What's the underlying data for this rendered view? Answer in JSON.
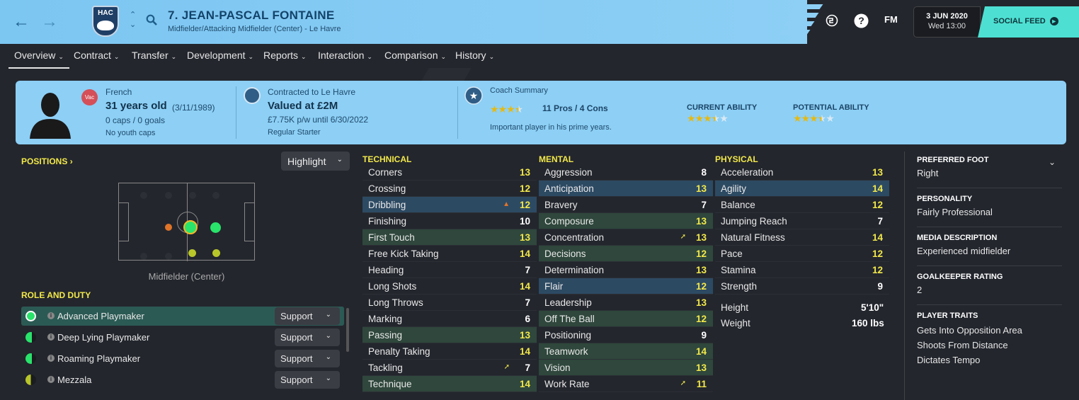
{
  "header": {
    "title": "7. JEAN-PASCAL FONTAINE",
    "subtitle": "Midfielder/Attacking Midfielder (Center) - Le Havre",
    "club_crest": "HAC",
    "fm_label": "FM",
    "date": "3 JUN 2020",
    "time": "Wed 13:00",
    "social_label": "SOCIAL FEED"
  },
  "tabs": [
    "Overview",
    "Contract",
    "Transfer",
    "Development",
    "Reports",
    "Interaction",
    "Comparison",
    "History"
  ],
  "summary": {
    "vacation_badge": "Vac",
    "nationality": "French",
    "age": "31 years old",
    "dob": "(3/11/1989)",
    "caps": "0 caps / 0 goals",
    "youth_caps": "No youth caps",
    "contract": "Contracted to Le Havre",
    "value": "Valued at £2M",
    "wage": "£7.75K p/w until 6/30/2022",
    "squad_status": "Regular Starter",
    "coach_summary_title": "Coach Summary",
    "coach_rating_stars": 3.5,
    "pros_cons": "11 Pros / 4 Cons",
    "coach_note": "Important player in his prime years.",
    "current_ability_label": "CURRENT ABILITY",
    "current_ability_stars": 3.5,
    "potential_ability_label": "POTENTIAL ABILITY",
    "potential_ability_stars": 3.5
  },
  "positions": {
    "title": "POSITIONS",
    "highlight_label": "Highlight",
    "position_name": "Midfielder (Center)"
  },
  "roles": {
    "title": "ROLE AND DUTY",
    "items": [
      {
        "name": "Advanced Playmaker",
        "duty": "Support"
      },
      {
        "name": "Deep Lying Playmaker",
        "duty": "Support"
      },
      {
        "name": "Roaming Playmaker",
        "duty": "Support"
      },
      {
        "name": "Mezzala",
        "duty": "Support"
      }
    ]
  },
  "technical": {
    "title": "TECHNICAL",
    "attrs": [
      {
        "name": "Corners",
        "value": "13"
      },
      {
        "name": "Crossing",
        "value": "12"
      },
      {
        "name": "Dribbling",
        "value": "12"
      },
      {
        "name": "Finishing",
        "value": "10"
      },
      {
        "name": "First Touch",
        "value": "13"
      },
      {
        "name": "Free Kick Taking",
        "value": "14"
      },
      {
        "name": "Heading",
        "value": "7"
      },
      {
        "name": "Long Shots",
        "value": "14"
      },
      {
        "name": "Long Throws",
        "value": "7"
      },
      {
        "name": "Marking",
        "value": "6"
      },
      {
        "name": "Passing",
        "value": "13"
      },
      {
        "name": "Penalty Taking",
        "value": "14"
      },
      {
        "name": "Tackling",
        "value": "7"
      },
      {
        "name": "Technique",
        "value": "14"
      }
    ]
  },
  "mental": {
    "title": "MENTAL",
    "attrs": [
      {
        "name": "Aggression",
        "value": "8"
      },
      {
        "name": "Anticipation",
        "value": "13"
      },
      {
        "name": "Bravery",
        "value": "7"
      },
      {
        "name": "Composure",
        "value": "13"
      },
      {
        "name": "Concentration",
        "value": "13"
      },
      {
        "name": "Decisions",
        "value": "12"
      },
      {
        "name": "Determination",
        "value": "13"
      },
      {
        "name": "Flair",
        "value": "12"
      },
      {
        "name": "Leadership",
        "value": "13"
      },
      {
        "name": "Off The Ball",
        "value": "12"
      },
      {
        "name": "Positioning",
        "value": "9"
      },
      {
        "name": "Teamwork",
        "value": "14"
      },
      {
        "name": "Vision",
        "value": "13"
      },
      {
        "name": "Work Rate",
        "value": "11"
      }
    ]
  },
  "physical": {
    "title": "PHYSICAL",
    "attrs": [
      {
        "name": "Acceleration",
        "value": "13"
      },
      {
        "name": "Agility",
        "value": "14"
      },
      {
        "name": "Balance",
        "value": "12"
      },
      {
        "name": "Jumping Reach",
        "value": "7"
      },
      {
        "name": "Natural Fitness",
        "value": "14"
      },
      {
        "name": "Pace",
        "value": "12"
      },
      {
        "name": "Stamina",
        "value": "12"
      },
      {
        "name": "Strength",
        "value": "9"
      }
    ],
    "height_label": "Height",
    "height": "5'10\"",
    "weight_label": "Weight",
    "weight": "160 lbs"
  },
  "info": {
    "preferred_foot_label": "PREFERRED FOOT",
    "preferred_foot": "Right",
    "personality_label": "PERSONALITY",
    "personality": "Fairly Professional",
    "media_label": "MEDIA DESCRIPTION",
    "media": "Experienced midfielder",
    "gk_label": "GOALKEEPER RATING",
    "gk": "2",
    "traits_label": "PLAYER TRAITS",
    "traits": [
      "Gets Into Opposition Area",
      "Shoots From Distance",
      "Dictates Tempo"
    ]
  },
  "colors": {
    "accent_yellow": "#f2e84a",
    "sky": "#8dcff5",
    "teal": "#4de0d2",
    "highlight_green": "#2f473c",
    "highlight_blue": "#2d4a63"
  }
}
